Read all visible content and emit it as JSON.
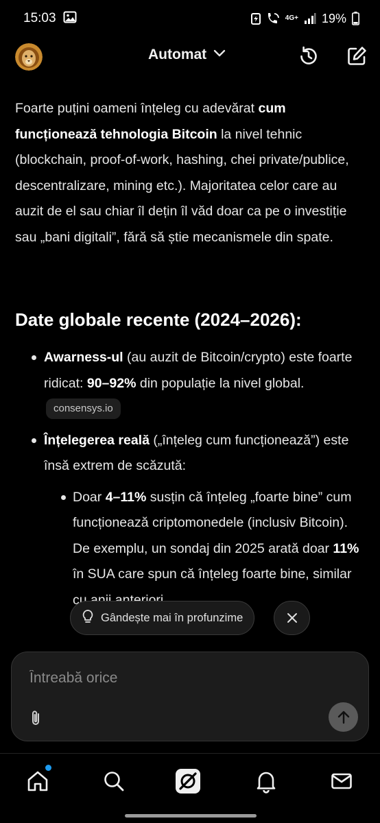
{
  "status_bar": {
    "time": "15:03",
    "network": "4G+",
    "battery": "19%"
  },
  "header": {
    "model_label": "Automat"
  },
  "message": {
    "paragraph": [
      {
        "text": "Foarte puțini oameni înțeleg cu adevărat ",
        "bold": false
      },
      {
        "text": "cum funcționează tehnologia Bitcoin",
        "bold": true
      },
      {
        "text": " la nivel tehnic (blockchain, proof-of-work, hashing, chei private/publice, descentralizare, mining etc.). Majoritatea celor care au auzit de el sau chiar îl dețin îl văd doar ca pe o investiție sau „bani digitali”, fără să știe mecanismele din spate.",
        "bold": false
      }
    ],
    "heading": "Date globale recente (2024–2026):",
    "bullets": [
      {
        "level": 1,
        "parts": [
          {
            "text": "Awarness-ul",
            "bold": true
          },
          {
            "text": " (au auzit de Bitcoin/crypto) este foarte ridicat: ",
            "bold": false
          },
          {
            "text": "90–92%",
            "bold": true
          },
          {
            "text": " din populație la nivel global.",
            "bold": false
          }
        ],
        "citation": "consensys.io"
      },
      {
        "level": 1,
        "parts": [
          {
            "text": "Înțelegerea reală",
            "bold": true
          },
          {
            "text": " („înțeleg cum funcționează”) este însă extrem de scăzută:",
            "bold": false
          }
        ]
      },
      {
        "level": 2,
        "parts": [
          {
            "text": "Doar ",
            "bold": false
          },
          {
            "text": "4–11%",
            "bold": true
          },
          {
            "text": " susțin că înțeleg „foarte bine” cum funcționează criptomonedele (inclusiv Bitcoin). De exemplu, un sondaj din 2025 arată doar ",
            "bold": false
          },
          {
            "text": "11%",
            "bold": true
          },
          {
            "text": " în SUA care spun că înțeleg foarte bine, similar cu anii anteriori.",
            "bold": false
          }
        ]
      }
    ]
  },
  "chips": {
    "think_deeper": "Gândește mai în profunzime"
  },
  "composer": {
    "placeholder": "Întreabă orice"
  },
  "icons": {
    "avatar": "lion-avatar",
    "history": "history-icon",
    "new_chat": "compose-icon",
    "bulb": "lightbulb-icon",
    "close": "close-icon",
    "attach": "paperclip-icon",
    "send": "arrow-up-icon",
    "nav": [
      "home-icon",
      "search-icon",
      "grok-icon",
      "bell-icon",
      "mail-icon"
    ]
  },
  "colors": {
    "background": "#000000",
    "notification_dot": "#1d9bf0"
  }
}
